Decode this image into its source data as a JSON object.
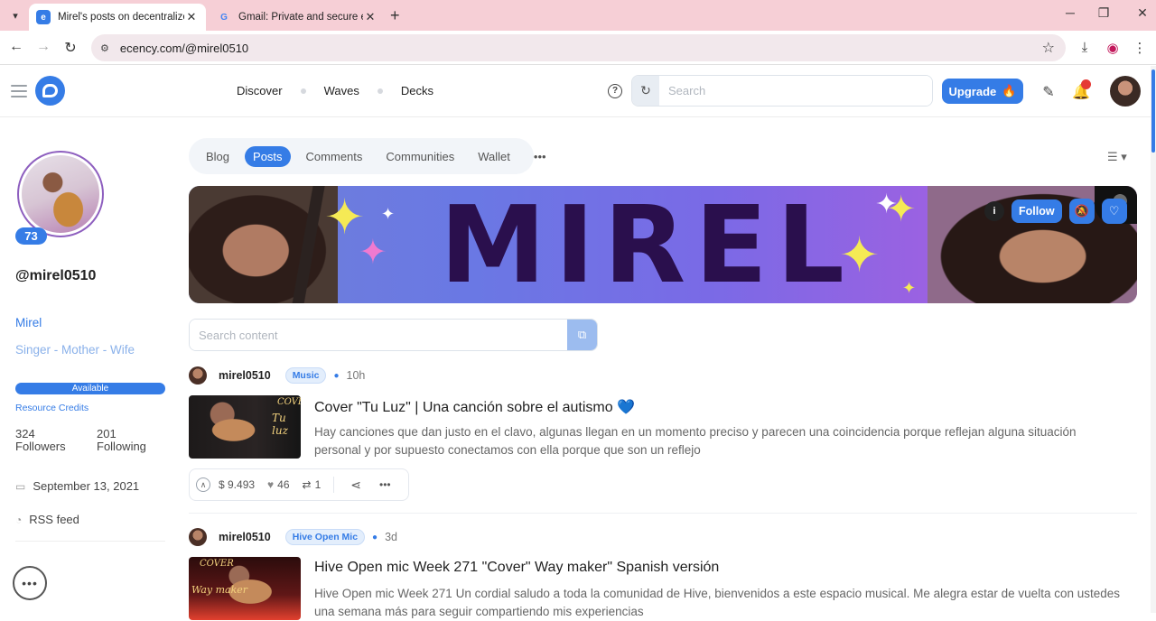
{
  "browser": {
    "tabs": [
      {
        "title": "Mirel's posts on decentralized w",
        "active": true
      },
      {
        "title": "Gmail: Private and secure email",
        "active": false
      }
    ],
    "url": "ecency.com/@mirel0510"
  },
  "header": {
    "nav": [
      "Discover",
      "Waves",
      "Decks"
    ],
    "search_placeholder": "Search",
    "upgrade_label": "Upgrade"
  },
  "profile": {
    "reputation": "73",
    "username": "@mirel0510",
    "display_name": "Mirel",
    "about": "Singer - Mother - Wife",
    "rc_status": "Available",
    "rc_label": "Resource Credits",
    "followers_count": "324",
    "followers_label": "Followers",
    "following_count": "201",
    "following_label": "Following",
    "joined": "September 13, 2021",
    "rss": "RSS feed"
  },
  "profile_tabs": [
    "Blog",
    "Posts",
    "Comments",
    "Communities",
    "Wallet"
  ],
  "cover": {
    "title": "MIREL",
    "follow_label": "Follow"
  },
  "content_search": {
    "placeholder": "Search content"
  },
  "posts": [
    {
      "author": "mirel0510",
      "community": "Music",
      "age": "10h",
      "thumb_text": [
        "COVER",
        "Tu luz"
      ],
      "title": "Cover \"Tu Luz\" | Una canción sobre el autismo 💙",
      "excerpt": "Hay canciones que dan justo en el clavo, algunas llegan en un momento preciso y parecen una coincidencia porque reflejan alguna situación personal y por supuesto conectamos con ella porque que son un reflejo",
      "payout": "$ 9.493",
      "votes": "46",
      "reblogs": "1"
    },
    {
      "author": "mirel0510",
      "community": "Hive Open Mic",
      "age": "3d",
      "thumb_text": [
        "COVER",
        "Way maker"
      ],
      "title": "Hive Open mic Week 271 \"Cover\" Way maker\" Spanish versión",
      "excerpt": "Hive Open mic Week 271 Un cordial saludo a toda la comunidad de Hive, bienvenidos a este espacio musical. Me alegra estar de vuelta con ustedes una semana más para seguir compartiendo mis experiencias"
    }
  ],
  "colors": {
    "accent": "#357ce6",
    "tabbar": "#f6cfd6",
    "cover_text": "#2a0f4d"
  }
}
